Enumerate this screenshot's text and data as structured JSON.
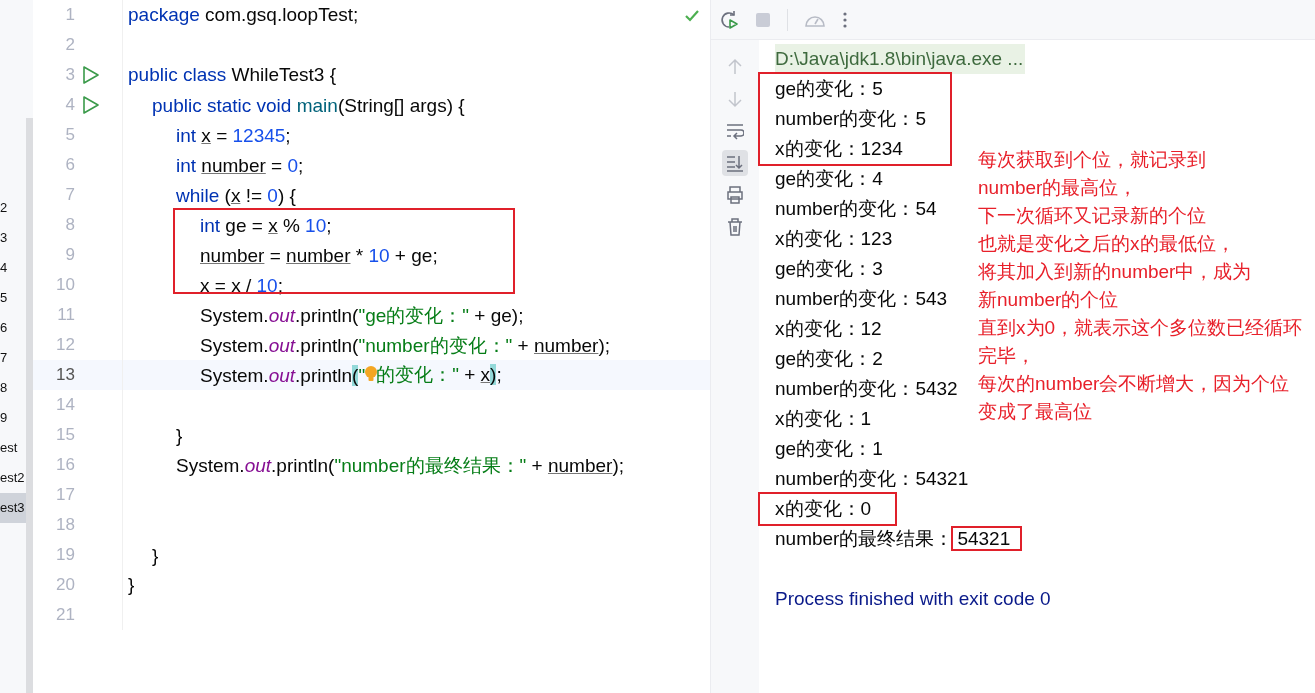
{
  "project_tree": {
    "items": [
      {
        "label": "2",
        "selected": false
      },
      {
        "label": "3",
        "selected": false
      },
      {
        "label": "4",
        "selected": false
      },
      {
        "label": "5",
        "selected": false
      },
      {
        "label": "6",
        "selected": false
      },
      {
        "label": "7",
        "selected": false
      },
      {
        "label": "8",
        "selected": false
      },
      {
        "label": "9",
        "selected": false
      },
      {
        "label": "est",
        "selected": false
      },
      {
        "label": "est2",
        "selected": false
      },
      {
        "label": "est3",
        "selected": true
      }
    ]
  },
  "editor": {
    "lines": [
      {
        "number": "1",
        "tokens": [
          {
            "text": "package",
            "kind": "keyword"
          },
          {
            "text": " com.gsq.loopTest;",
            "kind": "plain"
          }
        ]
      },
      {
        "number": "2"
      },
      {
        "number": "3",
        "runnable": true,
        "tokens": [
          {
            "text": "public class",
            "kind": "keyword"
          },
          {
            "text": " WhileTest3 {",
            "kind": "plain"
          }
        ]
      },
      {
        "number": "4",
        "runnable": true,
        "tokens": [
          {
            "text": "    public static void ",
            "kind": "keyword"
          },
          {
            "text": "main",
            "kind": "method"
          },
          {
            "text": "(String[] args) {",
            "kind": "plain"
          }
        ]
      },
      {
        "number": "5",
        "tokens": [
          {
            "text": "        int ",
            "kind": "keyword"
          },
          {
            "text": "x",
            "kind": "variable"
          },
          {
            "text": " = ",
            "kind": "plain"
          },
          {
            "text": "12345",
            "kind": "number"
          },
          {
            "text": ";",
            "kind": "plain"
          }
        ]
      },
      {
        "number": "6",
        "tokens": [
          {
            "text": "        int ",
            "kind": "keyword"
          },
          {
            "text": "number",
            "kind": "variable"
          },
          {
            "text": " = ",
            "kind": "plain"
          },
          {
            "text": "0",
            "kind": "number"
          },
          {
            "text": ";",
            "kind": "plain"
          }
        ]
      },
      {
        "number": "7",
        "tokens": [
          {
            "text": "        while",
            "kind": "keyword"
          },
          {
            "text": " (",
            "kind": "plain"
          },
          {
            "text": "x",
            "kind": "variable"
          },
          {
            "text": " != ",
            "kind": "plain"
          },
          {
            "text": "0",
            "kind": "number"
          },
          {
            "text": ") {",
            "kind": "plain"
          }
        ]
      },
      {
        "number": "8",
        "framed": true,
        "tokens": [
          {
            "text": "            int",
            "kind": "keyword"
          },
          {
            "text": " ge = ",
            "kind": "plain"
          },
          {
            "text": "x",
            "kind": "variable"
          },
          {
            "text": " % ",
            "kind": "plain"
          },
          {
            "text": "10",
            "kind": "number"
          },
          {
            "text": ";",
            "kind": "plain"
          }
        ]
      },
      {
        "number": "9",
        "framed": true,
        "tokens": [
          {
            "text": "            number",
            "kind": "variable"
          },
          {
            "text": " = ",
            "kind": "plain"
          },
          {
            "text": "number",
            "kind": "variable"
          },
          {
            "text": " * ",
            "kind": "plain"
          },
          {
            "text": "10",
            "kind": "number"
          },
          {
            "text": " + ge;",
            "kind": "plain"
          }
        ]
      },
      {
        "number": "10",
        "framed": true,
        "tokens": [
          {
            "text": "            x = x / ",
            "kind": "plain"
          },
          {
            "text": "10",
            "kind": "number"
          },
          {
            "text": ";",
            "kind": "plain"
          }
        ]
      },
      {
        "number": "11",
        "tokens": [
          {
            "text": "            System.",
            "kind": "plain"
          },
          {
            "text": "out",
            "kind": "field"
          },
          {
            "text": ".println(",
            "kind": "plain"
          },
          {
            "text": "\"ge的变化：\"",
            "kind": "string"
          },
          {
            "text": " + ge);",
            "kind": "plain"
          }
        ]
      },
      {
        "number": "12",
        "tokens": [
          {
            "text": "            System.",
            "kind": "plain"
          },
          {
            "text": "out",
            "kind": "field"
          },
          {
            "text": ".println(",
            "kind": "plain"
          },
          {
            "text": "\"number的变化：\"",
            "kind": "string"
          },
          {
            "text": " + ",
            "kind": "plain"
          },
          {
            "text": "number",
            "kind": "variable"
          },
          {
            "text": ");",
            "kind": "plain"
          }
        ]
      },
      {
        "number": "13",
        "current": true,
        "tokens": [
          {
            "text": "            System.",
            "kind": "plain"
          },
          {
            "text": "out",
            "kind": "field"
          },
          {
            "text": ".println",
            "kind": "plain"
          },
          {
            "text": "(",
            "kind": "bracket-match"
          },
          {
            "text": "\"",
            "kind": "string"
          },
          {
            "kind": "bulb"
          },
          {
            "text": "的变化：\"",
            "kind": "string"
          },
          {
            "text": " + ",
            "kind": "plain"
          },
          {
            "text": "x",
            "kind": "variable"
          },
          {
            "text": ")",
            "kind": "bracket-match"
          },
          {
            "text": ";",
            "kind": "plain"
          }
        ]
      },
      {
        "number": "14"
      },
      {
        "number": "15",
        "tokens": [
          {
            "text": "        }",
            "kind": "plain"
          }
        ]
      },
      {
        "number": "16",
        "tokens": [
          {
            "text": "        System.",
            "kind": "plain"
          },
          {
            "text": "out",
            "kind": "field"
          },
          {
            "text": ".println(",
            "kind": "plain"
          },
          {
            "text": "\"number的最终结果：\"",
            "kind": "string"
          },
          {
            "text": " + ",
            "kind": "plain"
          },
          {
            "text": "number",
            "kind": "variable"
          },
          {
            "text": ");",
            "kind": "plain"
          }
        ]
      },
      {
        "number": "17"
      },
      {
        "number": "18"
      },
      {
        "number": "19",
        "tokens": [
          {
            "text": "    }",
            "kind": "plain"
          }
        ]
      },
      {
        "number": "20",
        "tokens": [
          {
            "text": "}",
            "kind": "plain"
          }
        ]
      },
      {
        "number": "21"
      }
    ]
  },
  "console": {
    "toolbar": [
      {
        "kind": "rerun"
      },
      {
        "kind": "stop"
      },
      {
        "kind": "coverage"
      },
      {
        "kind": "more"
      }
    ],
    "side_tools": [
      {
        "kind": "up",
        "selected": false
      },
      {
        "kind": "down",
        "selected": false
      },
      {
        "kind": "soft-wrap",
        "selected": false
      },
      {
        "kind": "scroll-to-end",
        "selected": true
      },
      {
        "kind": "print",
        "selected": false
      },
      {
        "kind": "trash",
        "selected": false
      }
    ],
    "lines": [
      {
        "kind": "command",
        "text": "D:\\Java\\jdk1.8\\bin\\java.exe ..."
      },
      {
        "kind": "output",
        "text": "ge的变化：",
        "value": "5",
        "framed": true
      },
      {
        "kind": "output",
        "text": "number的变化：",
        "value": "5",
        "framed": true
      },
      {
        "kind": "output",
        "text": "x的变化：",
        "value": "1234",
        "framed": true
      },
      {
        "kind": "output",
        "text": "ge的变化：",
        "value": "4"
      },
      {
        "kind": "output",
        "text": "number的变化：",
        "value": "54"
      },
      {
        "kind": "output",
        "text": "x的变化：",
        "value": "123"
      },
      {
        "kind": "output",
        "text": "ge的变化：",
        "value": "3"
      },
      {
        "kind": "output",
        "text": "number的变化：",
        "value": "543"
      },
      {
        "kind": "output",
        "text": "x的变化：",
        "value": "12"
      },
      {
        "kind": "output",
        "text": "ge的变化：",
        "value": "2"
      },
      {
        "kind": "output",
        "text": "number的变化：",
        "value": "5432"
      },
      {
        "kind": "output",
        "text": "x的变化：",
        "value": "1"
      },
      {
        "kind": "output",
        "text": "ge的变化：",
        "value": "1"
      },
      {
        "kind": "output",
        "text": "number的变化：",
        "value": "54321"
      },
      {
        "kind": "output",
        "text": "x的变化：",
        "value": "0",
        "framed": true
      },
      {
        "kind": "output",
        "text": "number的最终结果：",
        "value": "54321",
        "value_framed": true
      },
      {
        "kind": "exit",
        "text": "Process finished with exit code 0"
      }
    ],
    "annotation": [
      "每次获取到个位，就记录到",
      "number的最高位，",
      "下一次循环又记录新的个位",
      "也就是变化之后的x的最低位，",
      "将其加入到新的number中，成为",
      "新number的个位",
      "直到x为0，就表示这个多位数已经循环",
      "完毕，",
      "每次的number会不断增大，因为个位",
      "变成了最高位"
    ]
  }
}
